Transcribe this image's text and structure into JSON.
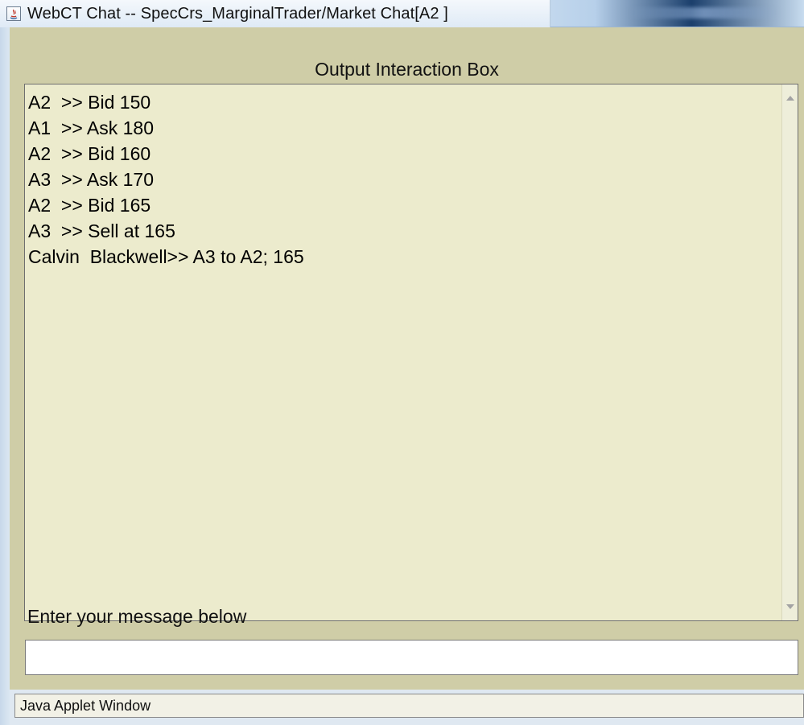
{
  "window": {
    "title": "WebCT Chat -- SpecCrs_MarginalTrader/Market Chat[A2 ]",
    "icon": "java-icon"
  },
  "output": {
    "label": "Output Interaction Box",
    "lines": [
      "A2  >> Bid 150",
      "A1  >> Ask 180",
      "A2  >> Bid 160",
      "A3  >> Ask 170",
      "A2  >> Bid 165",
      "A3  >> Sell at 165",
      "Calvin  Blackwell>> A3 to A2; 165"
    ]
  },
  "input": {
    "label": "Enter your message below",
    "value": ""
  },
  "status": {
    "text": "Java Applet Window"
  },
  "colors": {
    "panel": "#cfcda7",
    "output_background": "#ecebcd",
    "titlebar_accent": "#1b3f6c"
  }
}
